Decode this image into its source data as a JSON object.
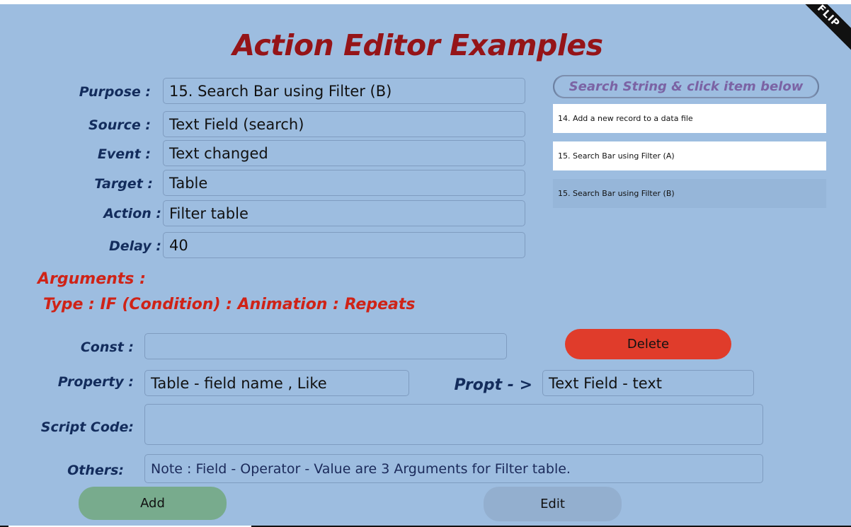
{
  "title": "Action Editor Examples",
  "ribbon_text": "FLIP",
  "form": {
    "purpose": {
      "label": "Purpose :",
      "value": "15. Search Bar using Filter (B)"
    },
    "source": {
      "label": "Source :",
      "value": "Text Field (search)"
    },
    "event": {
      "label": "Event :",
      "value": "Text changed"
    },
    "target": {
      "label": "Target :",
      "value": "Table"
    },
    "action": {
      "label": "Action :",
      "value": "Filter table"
    },
    "delay": {
      "label": "Delay :",
      "value": "40"
    }
  },
  "search": {
    "placeholder": "Search String & click item  below",
    "items": [
      {
        "label": "14. Add a new  record to a data file",
        "selected": false
      },
      {
        "label": "15. Search Bar using Filter (A)",
        "selected": false
      },
      {
        "label": "15. Search Bar using Filter (B)",
        "selected": true
      }
    ]
  },
  "arguments": {
    "heading": "Arguments :",
    "types": "Type :  IF (Condition) : Animation : Repeats",
    "const": {
      "label": "Const :",
      "value": ""
    },
    "property": {
      "label": "Property :",
      "value": "Table - field name , Like"
    },
    "propt": {
      "label": "Propt - >",
      "value": "Text Field - text"
    },
    "script": {
      "label": "Script  Code:",
      "value": ""
    },
    "others": {
      "label": "Others:",
      "value": "Note :  Field - Operator - Value are 3 Arguments for Filter table."
    }
  },
  "buttons": {
    "delete": "Delete",
    "add": "Add",
    "edit": "Edit"
  },
  "colors": {
    "background": "#9dbde0",
    "title": "#951418",
    "label": "#132c5c",
    "arguments": "#cf2317",
    "delete": "#e03c2b",
    "add": "#78ab8d",
    "edit": "#93afcf",
    "search_hint": "#7b63a4"
  }
}
